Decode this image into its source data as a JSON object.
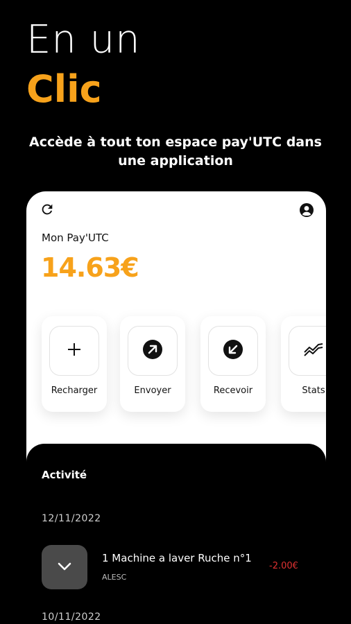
{
  "hero": {
    "line1": "En un",
    "line2": "Clic",
    "subtitle_line1": "Accède à tout ton espace pay'UTC dans",
    "subtitle_line2": "une application",
    "accent_color": "#f7a21b"
  },
  "header": {
    "refresh_icon": "refresh-icon",
    "account_icon": "account-circle-icon"
  },
  "balance": {
    "label": "Mon Pay'UTC",
    "amount": "14.63€"
  },
  "actions": [
    {
      "label": "Recharger",
      "icon": "plus-icon"
    },
    {
      "label": "Envoyer",
      "icon": "arrow-up-right-icon"
    },
    {
      "label": "Recevoir",
      "icon": "arrow-down-left-icon"
    },
    {
      "label": "Stats",
      "icon": "trend-icon"
    }
  ],
  "activity": {
    "title": "Activité",
    "groups": [
      {
        "date": "12/11/2022",
        "transactions": [
          {
            "title": "1 Machine a laver Ruche n°1",
            "subtitle": "ALESC",
            "amount": "-2.00€",
            "icon": "chevron-down-icon"
          }
        ]
      },
      {
        "date": "10/11/2022",
        "transactions": []
      }
    ],
    "negative_color": "#e03131"
  }
}
